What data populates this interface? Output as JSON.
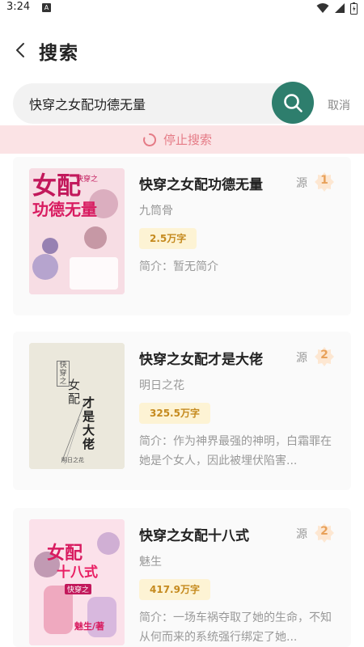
{
  "status_bar": {
    "time": "3:24",
    "notification_letter": "A"
  },
  "header": {
    "title": "搜索"
  },
  "search": {
    "query": "快穿之女配功德无量",
    "cancel_label": "取消"
  },
  "stop_banner": {
    "label": "停止搜索"
  },
  "colors": {
    "accent": "#2e7e6d",
    "banner_bg": "#fbe3e5",
    "banner_text": "#e57b86",
    "badge_bg": "#fdf3d4",
    "badge_text": "#c58a1e",
    "source_num": "#e8a15a"
  },
  "results": [
    {
      "title": "快穿之女配功德无量",
      "author": "九筒骨",
      "words": "2.5万字",
      "intro": "简介：暂无简介",
      "source_label": "源",
      "source_count": "1",
      "cover": {
        "icon": "cover-pink-anime",
        "line1": "女配",
        "line2": "功德无量",
        "tag": "快穿之"
      }
    },
    {
      "title": "快穿之女配才是大佬",
      "author": "明日之花",
      "words": "325.5万字",
      "intro": "简介：作为神界最强的神明，白霜罪在她是个女人，因此被埋伏陷害...",
      "source_label": "源",
      "source_count": "2",
      "cover": {
        "icon": "cover-plain-beige",
        "tag": "快穿之",
        "line1": "女配",
        "line2": "才是大佬",
        "author_mark": "明日之花"
      }
    },
    {
      "title": "快穿之女配十八式",
      "author": "魅生",
      "words": "417.9万字",
      "intro": "简介：一场车祸夺取了她的生命，不知从何而来的系统强行绑定了她...",
      "source_label": "源",
      "source_count": "2",
      "cover": {
        "icon": "cover-pink-anime",
        "line1": "女配",
        "line2": "十八式",
        "tag": "快穿之",
        "author_mark": "魅生/著"
      }
    }
  ]
}
